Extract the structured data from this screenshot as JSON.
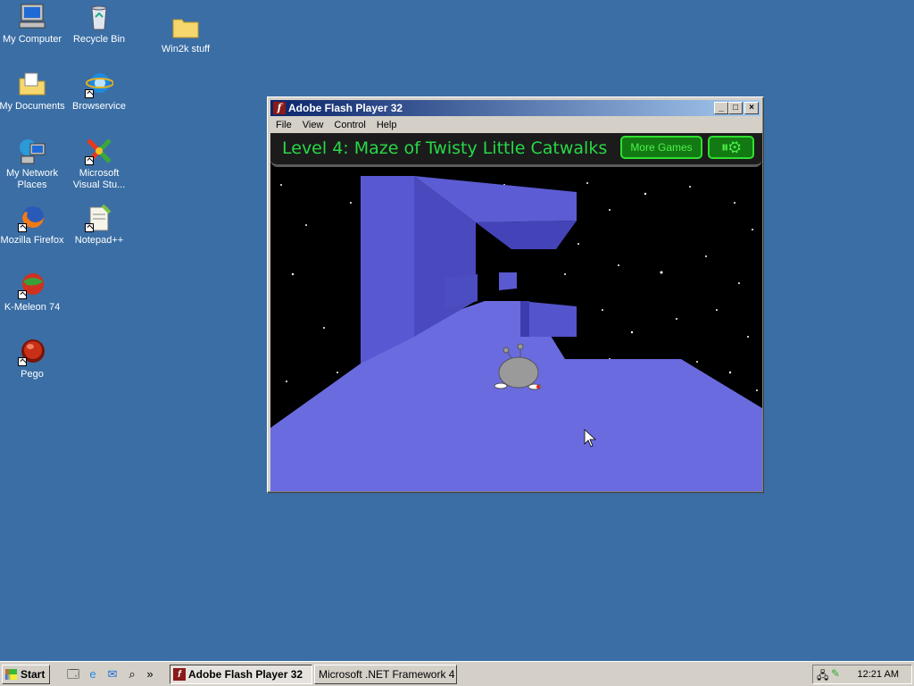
{
  "desktop": {
    "icons": [
      {
        "label": "My Computer",
        "icon": "computer-icon"
      },
      {
        "label": "Recycle Bin",
        "icon": "recycle-bin-icon"
      },
      {
        "label": "Win2k stuff",
        "icon": "folder-icon"
      },
      {
        "label": "My Documents",
        "icon": "documents-folder-icon"
      },
      {
        "label": "Browservice",
        "icon": "internet-explorer-icon"
      },
      {
        "label": "My Network Places",
        "icon": "network-places-icon"
      },
      {
        "label": "Microsoft Visual Stu...",
        "icon": "visual-studio-icon"
      },
      {
        "label": "Mozilla Firefox",
        "icon": "firefox-icon"
      },
      {
        "label": "Notepad++",
        "icon": "notepad-plus-plus-icon"
      },
      {
        "label": "K-Meleon 74",
        "icon": "k-meleon-icon"
      },
      {
        "label": "Pego",
        "icon": "pego-icon"
      }
    ]
  },
  "window": {
    "title": "Adobe Flash Player 32",
    "menu": [
      "File",
      "View",
      "Control",
      "Help"
    ],
    "controls": [
      "minimize",
      "maximize",
      "close"
    ]
  },
  "game": {
    "level_title": "Level 4: Maze of Twisty Little Catwalks",
    "more_games_label": "More Games",
    "pause_settings_icon": "pause-settings-icon",
    "colors": {
      "hud_text": "#27d847",
      "floor": "#6b6be0",
      "space": "#000000"
    }
  },
  "taskbar": {
    "start_label": "Start",
    "quick_launch": [
      "show-desktop-icon",
      "internet-explorer-icon",
      "outlook-express-icon",
      "search-icon"
    ],
    "overflow": "»",
    "tasks": [
      {
        "label": "Adobe Flash Player 32",
        "active": true
      },
      {
        "label": "Microsoft .NET Framework 4 ...",
        "active": false
      }
    ],
    "clock": "12:21 AM"
  }
}
